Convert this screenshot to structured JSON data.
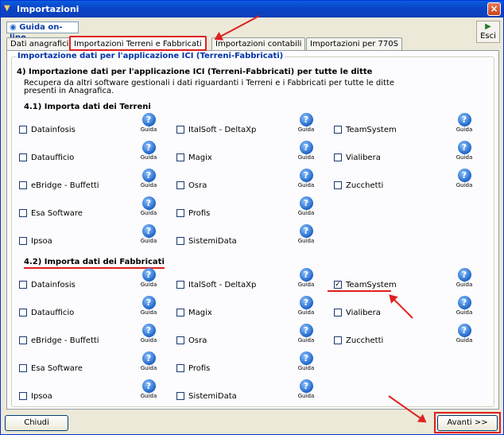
{
  "window": {
    "title": "Importazioni"
  },
  "toolbar": {
    "guida_online": "Guida on-line",
    "esci": "Esci"
  },
  "tabs": [
    {
      "label": "Dati anagrafici"
    },
    {
      "label": "Importazioni Terreni e Fabbricati"
    },
    {
      "label": "Importazioni contabili"
    },
    {
      "label": "Importazioni per 770S"
    }
  ],
  "group": {
    "title": "Importazione dati per l'applicazione ICI (Terreni-Fabbricati)",
    "heading": "4) Importazione dati per l'applicazione ICI (Terreni-Fabbricati) per tutte le ditte",
    "desc_line1": "Recupera da altri software gestionali i dati riguardanti i Terreni e i Fabbricati per tutte le ditte",
    "desc_line2": "presenti in Anagrafica.",
    "terreni_title": "4.1) Importa dati dei Terreni",
    "fabbricati_title": "4.2) Importa dati dei Fabbricati"
  },
  "guida_label": "Guida",
  "guida_glyph": "?",
  "check_glyph": "✓",
  "terreni": {
    "col1": [
      "Datainfosis",
      "Dataufficio",
      "eBridge - Buffetti",
      "Esa Software",
      "Ipsoa"
    ],
    "col2": [
      "ItalSoft - DeltaXp",
      "Magix",
      "Osra",
      "Profis",
      "SistemiData"
    ],
    "col3": [
      "TeamSystem",
      "Vialibera",
      "Zucchetti"
    ]
  },
  "fabbricati": {
    "col1": [
      "Datainfosis",
      "Dataufficio",
      "eBridge - Buffetti",
      "Esa Software",
      "Ipsoa"
    ],
    "col2": [
      "ItalSoft - DeltaXp",
      "Magix",
      "Osra",
      "Profis",
      "SistemiData"
    ],
    "col3": [
      "TeamSystem",
      "Vialibera",
      "Zucchetti"
    ],
    "checked": "TeamSystem"
  },
  "buttons": {
    "chiudi": "Chiudi",
    "avanti": "Avanti >>"
  },
  "colors": {
    "highlight": "#e02020",
    "title_blue": "#0033aa"
  }
}
